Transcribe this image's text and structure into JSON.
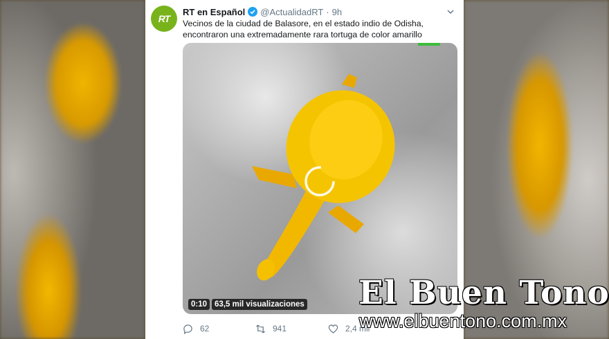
{
  "tweet": {
    "avatar_text": "RT",
    "name": "RT en Español",
    "handle": "@ActualidadRT",
    "separator": "·",
    "time": "9h",
    "text": "Vecinos de la ciudad de Balasore, en el estado indio de Odisha, encontraron una extremadamente rara tortuga de color amarillo",
    "video": {
      "duration": "0:10",
      "views": "63,5 mil visualizaciones"
    },
    "actions": {
      "replies": "62",
      "retweets": "941",
      "likes": "2,4 mil"
    }
  },
  "watermark": {
    "title": "El Buen Tono",
    "url": "www.elbuentono.com.mx"
  },
  "colors": {
    "rt_green": "#79b31b",
    "verified_blue": "#1da1f2",
    "turtle_yellow": "#f5c400"
  }
}
